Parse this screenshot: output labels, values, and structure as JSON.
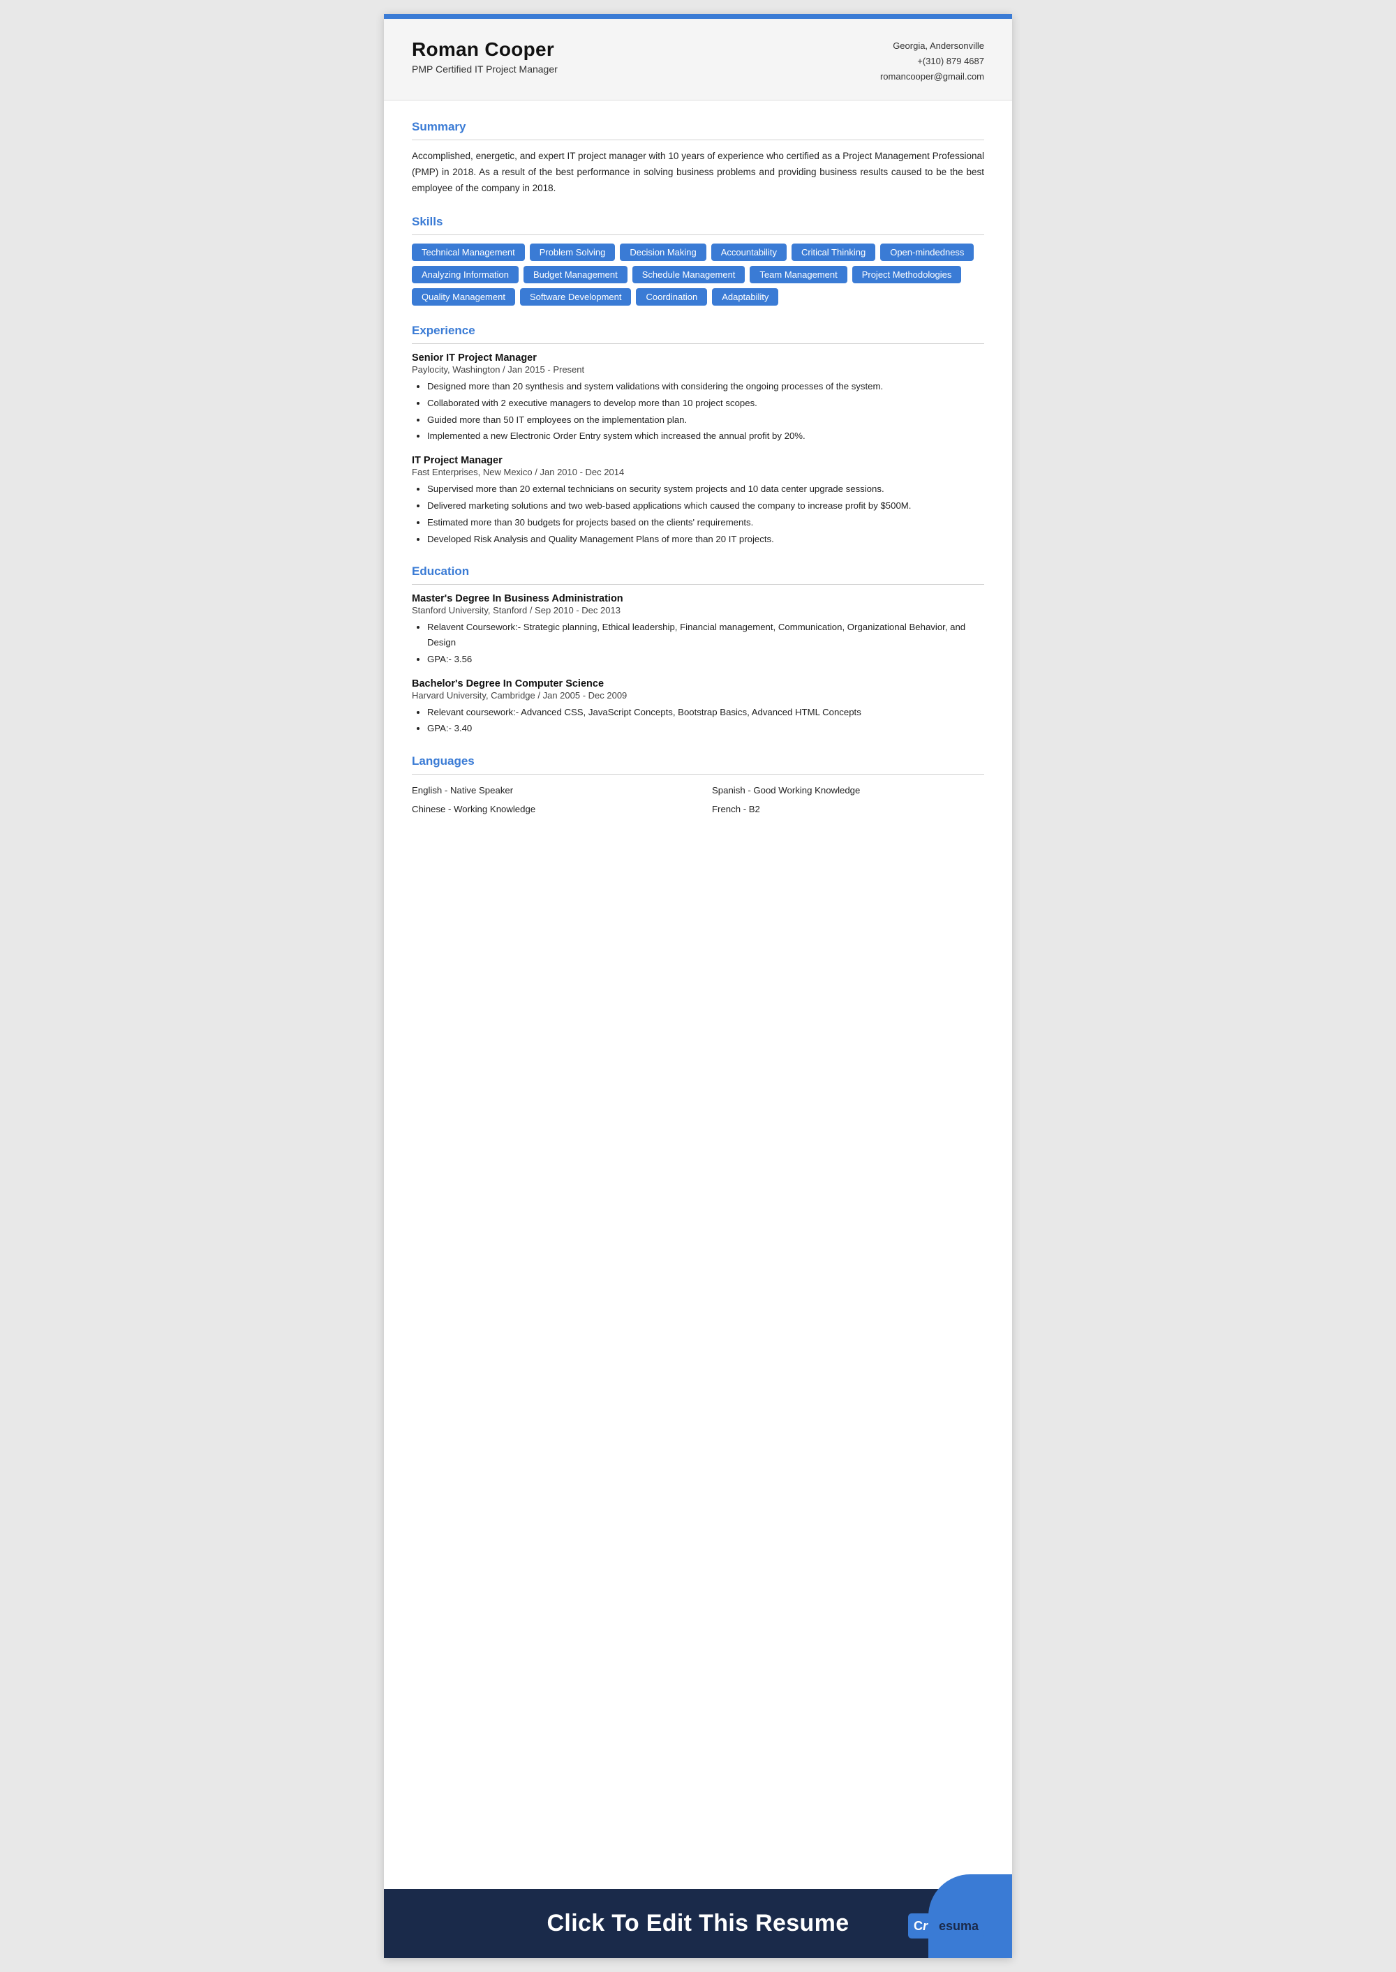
{
  "header": {
    "name": "Roman Cooper",
    "title": "PMP Certified IT Project Manager",
    "location": "Georgia, Andersonville",
    "phone": "+(310) 879 4687",
    "email": "romancooper@gmail.com"
  },
  "summary": {
    "section_title": "Summary",
    "text": "Accomplished, energetic, and expert IT project manager with 10 years of experience who certified as a Project Management Professional (PMP) in 2018. As a result of the best performance in solving business problems and providing business results caused to be the best employee of the company in 2018."
  },
  "skills": {
    "section_title": "Skills",
    "items": [
      "Technical Management",
      "Problem Solving",
      "Decision Making",
      "Accountability",
      "Critical Thinking",
      "Open-mindedness",
      "Analyzing Information",
      "Budget Management",
      "Schedule Management",
      "Team Management",
      "Project Methodologies",
      "Quality Management",
      "Software Development",
      "Coordination",
      "Adaptability"
    ]
  },
  "experience": {
    "section_title": "Experience",
    "jobs": [
      {
        "title": "Senior IT Project Manager",
        "company": "Paylocity, Washington / Jan 2015 - Present",
        "bullets": [
          "Designed more than 20 synthesis and system validations with considering the ongoing processes of the system.",
          "Collaborated with 2 executive managers to develop more than 10 project scopes.",
          "Guided more than 50 IT employees on the implementation plan.",
          "Implemented a new Electronic Order Entry system which increased the annual profit by 20%."
        ]
      },
      {
        "title": "IT Project Manager",
        "company": "Fast Enterprises, New Mexico / Jan 2010 - Dec 2014",
        "bullets": [
          "Supervised more than 20 external technicians on security system projects and 10 data center upgrade sessions.",
          "Delivered marketing solutions and two web-based applications which caused the company to increase profit by $500M.",
          "Estimated more than 30 budgets for projects based on the clients' requirements.",
          "Developed Risk Analysis and Quality Management Plans of more than 20 IT projects."
        ]
      }
    ]
  },
  "education": {
    "section_title": "Education",
    "degrees": [
      {
        "title": "Master's Degree In Business Administration",
        "school": "Stanford University, Stanford / Sep 2010 - Dec 2013",
        "bullets": [
          "Relavent Coursework:- Strategic planning, Ethical leadership, Financial management, Communication, Organizational Behavior, and Design",
          "GPA:- 3.56"
        ]
      },
      {
        "title": "Bachelor's Degree In Computer Science",
        "school": "Harvard University, Cambridge / Jan 2005 - Dec 2009",
        "bullets": [
          "Relevant coursework:- Advanced CSS, JavaScript Concepts,  Bootstrap Basics, Advanced HTML Concepts",
          "GPA:- 3.40"
        ]
      }
    ]
  },
  "languages": {
    "section_title": "Languages",
    "items": [
      {
        "lang": "English - Native Speaker",
        "col": 1
      },
      {
        "lang": "Spanish - Good Working Knowledge",
        "col": 2
      },
      {
        "lang": "Chinese - Working Knowledge",
        "col": 1
      },
      {
        "lang": "French - B2",
        "col": 2
      }
    ]
  },
  "footer": {
    "cta_text": "Click To Edit This Resume",
    "logo_icon": "Cr",
    "logo_text": "esuma"
  }
}
